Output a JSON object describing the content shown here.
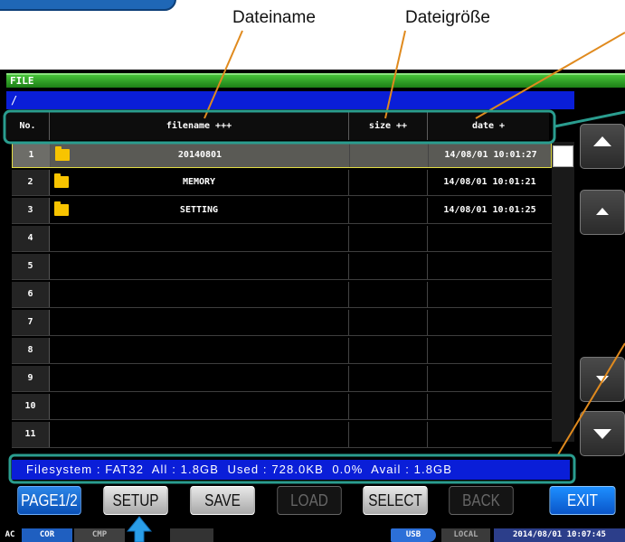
{
  "annotations": {
    "filename_label": "Dateiname",
    "size_label": "Dateigröße"
  },
  "window": {
    "title": "FILE",
    "path": "/"
  },
  "table": {
    "headers": {
      "no": "No.",
      "filename": "filename +++",
      "size": "size ++",
      "date": "date +"
    },
    "rows": [
      {
        "no": "1",
        "name": "20140801",
        "size": "",
        "date": "14/08/01 10:01:27",
        "folder": true,
        "selected": true
      },
      {
        "no": "2",
        "name": "MEMORY",
        "size": "",
        "date": "14/08/01 10:01:21",
        "folder": true,
        "selected": false
      },
      {
        "no": "3",
        "name": "SETTING",
        "size": "",
        "date": "14/08/01 10:01:25",
        "folder": true,
        "selected": false
      },
      {
        "no": "4",
        "name": "",
        "size": "",
        "date": "",
        "folder": false,
        "selected": false
      },
      {
        "no": "5",
        "name": "",
        "size": "",
        "date": "",
        "folder": false,
        "selected": false
      },
      {
        "no": "6",
        "name": "",
        "size": "",
        "date": "",
        "folder": false,
        "selected": false
      },
      {
        "no": "7",
        "name": "",
        "size": "",
        "date": "",
        "folder": false,
        "selected": false
      },
      {
        "no": "8",
        "name": "",
        "size": "",
        "date": "",
        "folder": false,
        "selected": false
      },
      {
        "no": "9",
        "name": "",
        "size": "",
        "date": "",
        "folder": false,
        "selected": false
      },
      {
        "no": "10",
        "name": "",
        "size": "",
        "date": "",
        "folder": false,
        "selected": false
      },
      {
        "no": "11",
        "name": "",
        "size": "",
        "date": "",
        "folder": false,
        "selected": false
      }
    ]
  },
  "status_line": "Filesystem : FAT32  All : 1.8GB  Used : 728.0KB  0.0%  Avail : 1.8GB",
  "buttons": {
    "page": "PAGE1/2",
    "setup": "SETUP",
    "save": "SAVE",
    "load": "LOAD",
    "select": "SELECT",
    "back": "BACK",
    "exit": "EXIT"
  },
  "statusbar": {
    "ac": "AC",
    "cor": "COR",
    "cmp": "CMP",
    "usb": "USB",
    "local": "LOCAL",
    "datetime": "2014/08/01 10:07:45"
  },
  "colors": {
    "accent_blue": "#0a1ed8",
    "highlight_teal": "#2a9d8f",
    "leader_orange": "#e08a1e",
    "folder_yellow": "#f8c400",
    "title_green": "#2ea22a"
  }
}
